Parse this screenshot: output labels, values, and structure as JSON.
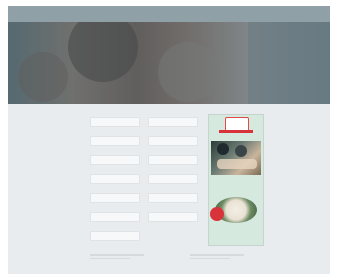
{
  "nav": {
    "left": "",
    "center": "",
    "right": ""
  },
  "hero": {
    "title": ""
  },
  "form": {
    "rows": [
      {
        "left": "",
        "right": ""
      },
      {
        "left": "",
        "right": ""
      },
      {
        "left": "",
        "right": ""
      },
      {
        "left": "",
        "right": ""
      },
      {
        "left": "",
        "right": ""
      },
      {
        "left": "",
        "right": ""
      },
      {
        "left": "",
        "right": ""
      }
    ]
  },
  "promo": {
    "brand": "",
    "text1": "",
    "badge": "",
    "text2": ""
  },
  "footer": {
    "col1_heading": "",
    "col2_heading": ""
  },
  "colors": {
    "nav": "#8fa1a6",
    "page": "#e9ecee",
    "promo": "#d6e9df",
    "accent": "#d8323a"
  }
}
